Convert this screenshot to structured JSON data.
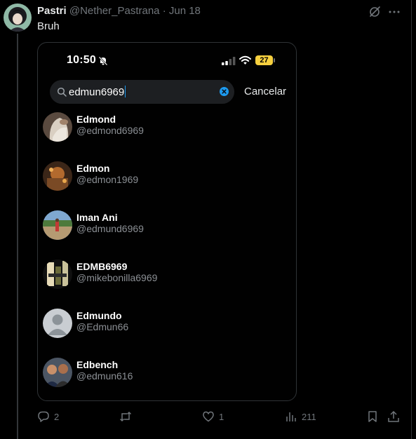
{
  "tweet": {
    "display_name": "Pastri",
    "handle": "@Nether_Pastrana",
    "separator": "·",
    "date": "Jun 18",
    "text": "Bruh"
  },
  "phone_screenshot": {
    "status_bar": {
      "time": "10:50",
      "battery": "27",
      "battery_color": "#f6d03f"
    },
    "search": {
      "value": "edmun6969",
      "cancel_label": "Cancelar",
      "clear_color": "#1d9bf0"
    },
    "results": [
      {
        "name": "Edmond",
        "handle": "@edmond6969"
      },
      {
        "name": "Edmon",
        "handle": "@edmon1969"
      },
      {
        "name": "Iman Ani",
        "handle": "@edmund6969"
      },
      {
        "name": "EDMB6969",
        "handle": "@mikebonilla6969"
      },
      {
        "name": "Edmundo",
        "handle": "@Edmun66"
      },
      {
        "name": "Edbench",
        "handle": "@edmun616"
      }
    ]
  },
  "actions": {
    "replies": "2",
    "reposts": "",
    "likes": "1",
    "views": "211"
  },
  "icons": [
    "grok-icon",
    "more-icon",
    "bell-slash-icon",
    "signal-icon",
    "wifi-icon",
    "search-icon",
    "clear-icon",
    "reply-icon",
    "repost-icon",
    "like-icon",
    "views-icon",
    "bookmark-icon",
    "share-icon"
  ]
}
